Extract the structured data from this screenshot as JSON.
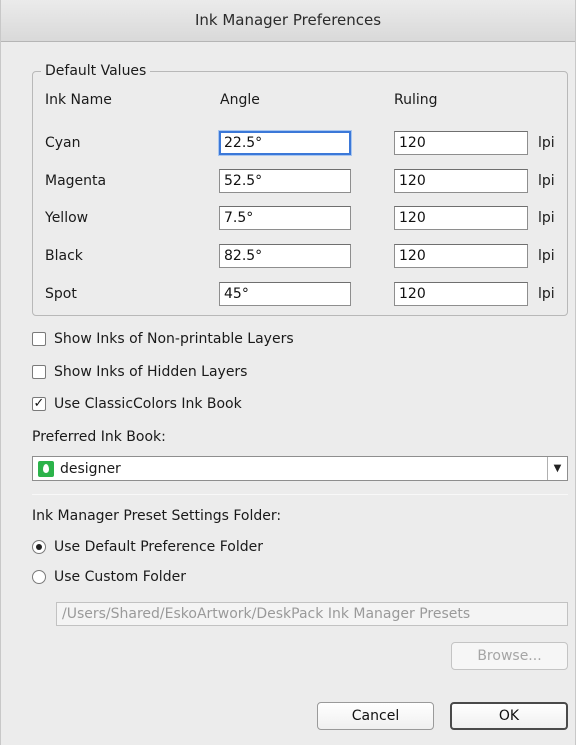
{
  "window": {
    "title": "Ink Manager Preferences"
  },
  "default_values": {
    "legend": "Default Values",
    "headers": {
      "ink_name": "Ink Name",
      "angle": "Angle",
      "ruling": "Ruling"
    },
    "unit": "lpi",
    "rows": [
      {
        "name": "Cyan",
        "angle": "22.5°",
        "ruling": "120"
      },
      {
        "name": "Magenta",
        "angle": "52.5°",
        "ruling": "120"
      },
      {
        "name": "Yellow",
        "angle": "7.5°",
        "ruling": "120"
      },
      {
        "name": "Black",
        "angle": "82.5°",
        "ruling": "120"
      },
      {
        "name": "Spot",
        "angle": "45°",
        "ruling": "120"
      }
    ]
  },
  "options": {
    "show_non_printable": {
      "label": "Show Inks of Non-printable Layers",
      "checked": false
    },
    "show_hidden": {
      "label": "Show Inks of Hidden Layers",
      "checked": false
    },
    "use_classiccolors": {
      "label": "Use ClassicColors Ink Book",
      "checked": true
    }
  },
  "preferred_ink_book": {
    "label": "Preferred Ink Book:",
    "selected": "designer",
    "icon": "ink-book-icon",
    "icon_color": "#2bb34a"
  },
  "preset_folder": {
    "label": "Ink Manager Preset Settings Folder:",
    "default_option": "Use Default Preference Folder",
    "custom_option": "Use Custom Folder",
    "selected": "default",
    "custom_path": "/Users/Shared/EskoArtwork/DeskPack Ink Manager Presets",
    "browse_label": "Browse..."
  },
  "buttons": {
    "cancel": "Cancel",
    "ok": "OK"
  },
  "colors": {
    "focus": "#3b78d8",
    "dialog_bg": "#ececec"
  }
}
